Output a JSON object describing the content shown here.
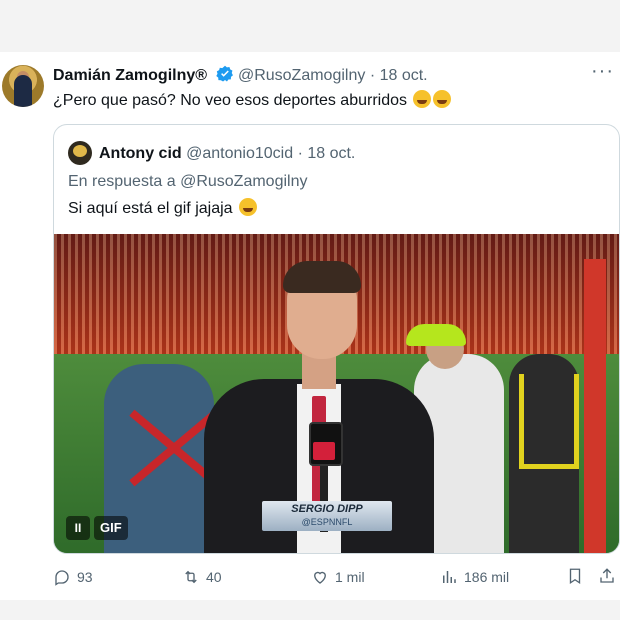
{
  "post": {
    "author_name": "Damián Zamogilny",
    "registered_mark": "®",
    "handle": "@RusoZamogilny",
    "separator": "·",
    "date": "18 oct.",
    "more_label": "···",
    "text": "¿Pero que pasó? No veo esos deportes aburridos"
  },
  "quote": {
    "author_name": "Antony cid",
    "handle": "@antonio10cid",
    "separator": "·",
    "date": "18 oct.",
    "reply_prefix": "En respuesta a",
    "reply_mention": "@RusoZamogilny",
    "text": "Si aquí está el gif jajaja",
    "media": {
      "lower_third_name": "SERGIO DIPP",
      "lower_third_handle": "@ESPNNFL",
      "gif_label": "GIF",
      "pause_label": "II"
    }
  },
  "actions": {
    "replies": "93",
    "reposts": "40",
    "likes": "1 mil",
    "views": "186 mil"
  },
  "colors": {
    "text": "#0f1419",
    "secondary": "#536471",
    "verified": "#1d9bf0",
    "border": "#cfd9de"
  },
  "icons": [
    "verified-badge-icon",
    "more-icon",
    "reply-icon",
    "repost-icon",
    "like-icon",
    "views-icon",
    "bookmark-icon",
    "share-icon",
    "laughing-emoji-icon"
  ]
}
